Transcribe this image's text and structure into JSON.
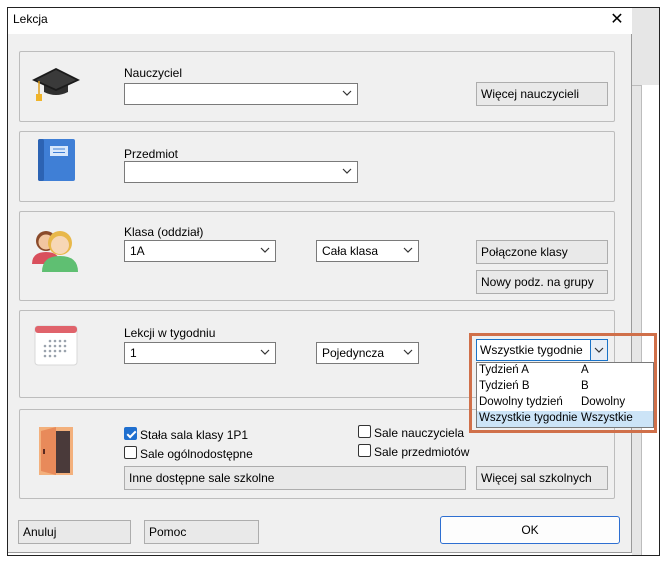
{
  "window": {
    "title": "Lekcja",
    "close_symbol": "✕"
  },
  "teacher": {
    "label": "Nauczyciel",
    "value": "",
    "more_button": "Więcej nauczycieli"
  },
  "subject": {
    "label": "Przedmiot",
    "value": ""
  },
  "class": {
    "label": "Klasa (oddział)",
    "value": "1A",
    "group_value": "Cała klasa",
    "combined_button": "Połączone klasy",
    "new_split_button": "Nowy podz. na grupy"
  },
  "lessons": {
    "label": "Lekcji w tygodniu",
    "value": "1",
    "type_value": "Pojedyncza",
    "weeks_value": "Wszystkie tygodnie",
    "weeks_options": [
      {
        "name": "Tydzień A",
        "short": "A"
      },
      {
        "name": "Tydzień B",
        "short": "B"
      },
      {
        "name": "Dowolny tydzień",
        "short": "Dowolny"
      },
      {
        "name": "Wszystkie tygodnie",
        "short": "Wszystkie"
      }
    ]
  },
  "rooms": {
    "fixed_room_label": "Stała sala klasy 1P1",
    "fixed_room_checked": true,
    "public_rooms_label": "Sale ogólnodostępne",
    "public_rooms_checked": false,
    "teacher_rooms_label": "Sale nauczyciela",
    "teacher_rooms_checked": false,
    "subject_rooms_label": "Sale przedmiotów",
    "subject_rooms_checked": false,
    "other_rooms_field": "Inne dostępne sale szkolne",
    "more_rooms_button": "Więcej sal szkolnych"
  },
  "footer": {
    "cancel": "Anuluj",
    "help": "Pomoc",
    "ok": "OK"
  },
  "colors": {
    "accent": "#1a73c8",
    "highlight_border": "#d0704a",
    "selected_item": "#cce4f7"
  }
}
